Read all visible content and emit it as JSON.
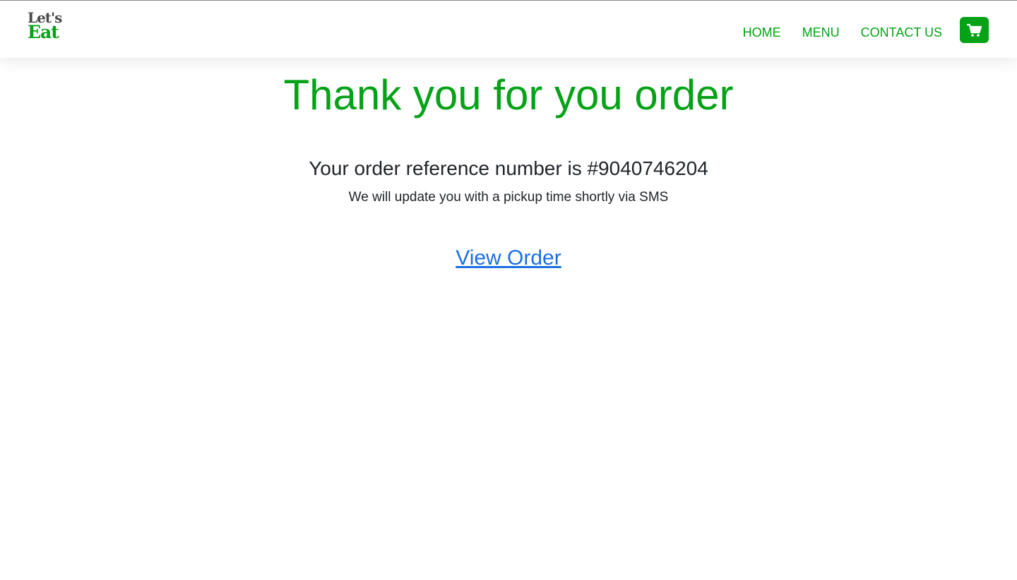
{
  "brand": {
    "line1": "Let's",
    "line2": "Eat",
    "colors": {
      "dark": "#4a4a4a",
      "green": "#04a216"
    }
  },
  "nav": {
    "items": [
      {
        "label": "HOME"
      },
      {
        "label": "MENU"
      },
      {
        "label": "CONTACT US"
      }
    ],
    "cart_icon": "shopping-cart-icon"
  },
  "confirmation": {
    "title": "Thank you for you order",
    "reference_text": "Your order reference number is #9040746204",
    "message": "We will update you with a pickup time shortly via SMS",
    "view_order_link": "View Order"
  },
  "colors": {
    "accent": "#04a216",
    "text": "#212529",
    "link": "#1a6fe0",
    "background": "#ffffff"
  }
}
